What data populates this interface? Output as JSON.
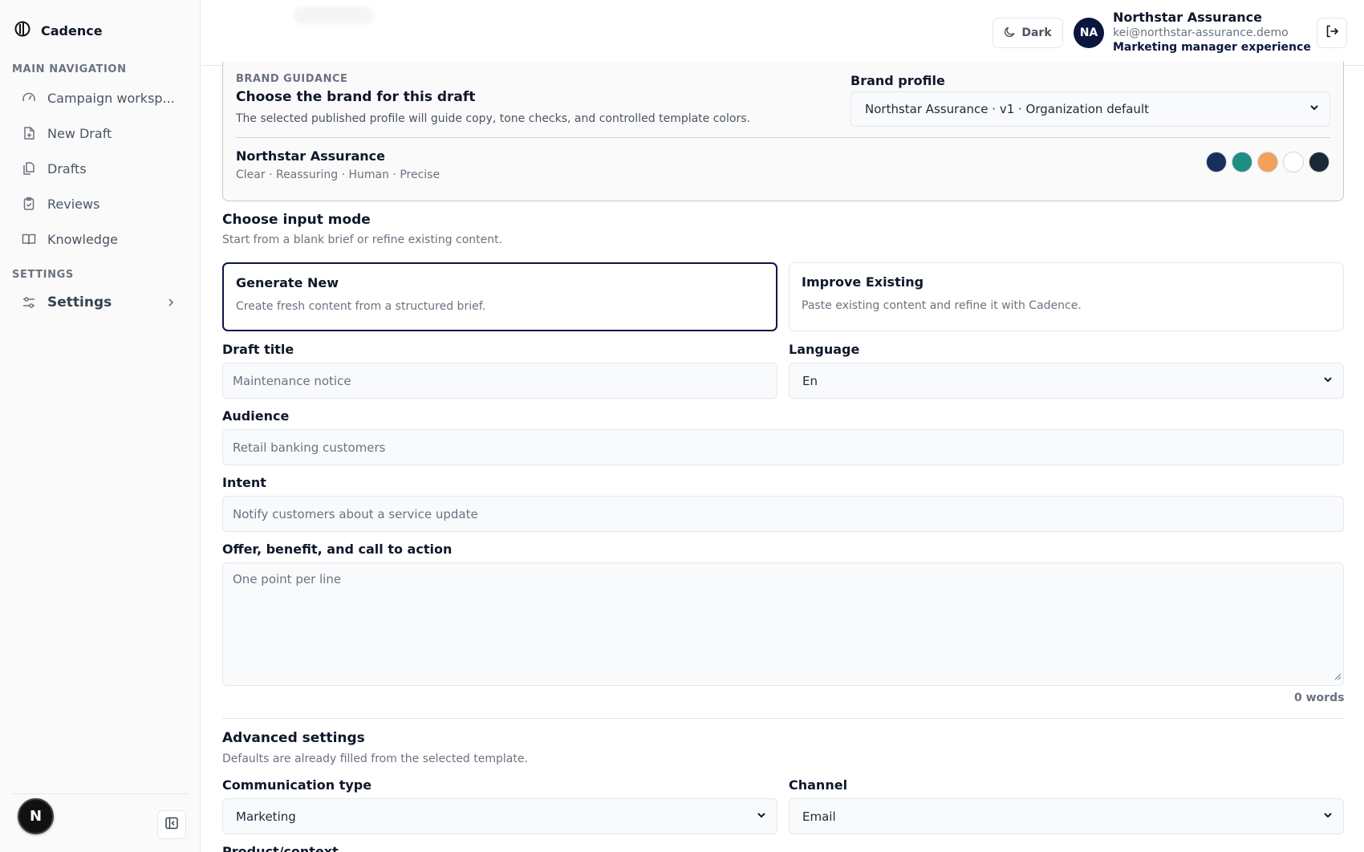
{
  "app": {
    "name": "Cadence"
  },
  "sidebar": {
    "main_section_label": "MAIN NAVIGATION",
    "items": [
      {
        "label": "Campaign worksp...",
        "icon": "gauge-icon"
      },
      {
        "label": "New Draft",
        "icon": "file-plus-icon"
      },
      {
        "label": "Drafts",
        "icon": "files-icon"
      },
      {
        "label": "Reviews",
        "icon": "clipboard-check-icon"
      },
      {
        "label": "Knowledge",
        "icon": "book-open-icon"
      }
    ],
    "settings_section_label": "SETTINGS",
    "settings_label": "Settings",
    "footer_badge": "N"
  },
  "header": {
    "theme_toggle_label": "Dark",
    "user": {
      "initials": "NA",
      "name": "Northstar Assurance",
      "email": "kei@northstar-assurance.demo",
      "role": "Marketing manager experience"
    }
  },
  "brand_guidance": {
    "eyebrow": "BRAND GUIDANCE",
    "title": "Choose the brand for this draft",
    "description": "The selected published profile will guide copy, tone checks, and controlled template colors.",
    "profile_label": "Brand profile",
    "profile_value": "Northstar Assurance · v1 · Organization default",
    "brand_name": "Northstar Assurance",
    "tone": "Clear · Reassuring · Human · Precise",
    "palette": [
      "#17305a",
      "#1f8e85",
      "#f2a05a",
      "#ffffff",
      "#1b2838"
    ]
  },
  "input_mode": {
    "title": "Choose input mode",
    "subtitle": "Start from a blank brief or refine existing content.",
    "options": [
      {
        "title": "Generate New",
        "description": "Create fresh content from a structured brief.",
        "selected": true
      },
      {
        "title": "Improve Existing",
        "description": "Paste existing content and refine it with Cadence.",
        "selected": false
      }
    ]
  },
  "form": {
    "draft_title_label": "Draft title",
    "draft_title_placeholder": "Maintenance notice",
    "language_label": "Language",
    "language_value": "En",
    "audience_label": "Audience",
    "audience_placeholder": "Retail banking customers",
    "intent_label": "Intent",
    "intent_placeholder": "Notify customers about a service update",
    "offer_label": "Offer, benefit, and call to action",
    "offer_placeholder": "One point per line",
    "word_count": "0 words"
  },
  "advanced": {
    "title": "Advanced settings",
    "subtitle": "Defaults are already filled from the selected template.",
    "communication_type_label": "Communication type",
    "communication_type_value": "Marketing",
    "channel_label": "Channel",
    "channel_value": "Email",
    "next_label": "Product/context"
  }
}
